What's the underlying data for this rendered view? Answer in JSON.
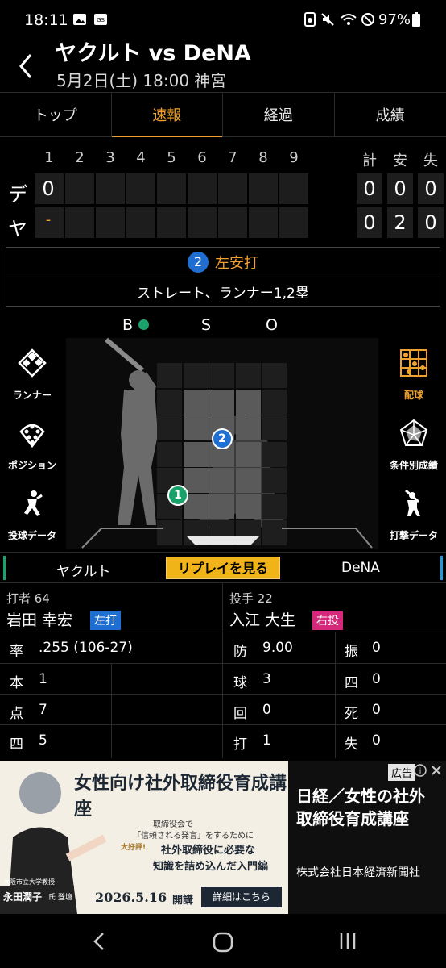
{
  "status": {
    "time": "18:11",
    "battery": "97%"
  },
  "header": {
    "title": "ヤクルト vs DeNA",
    "subtitle": "5月2日(土) 18:00 神宮"
  },
  "tabs": [
    {
      "label": "トップ"
    },
    {
      "label": "速報"
    },
    {
      "label": "経過"
    },
    {
      "label": "成績"
    }
  ],
  "scoreboard": {
    "innings": [
      "1",
      "2",
      "3",
      "4",
      "5",
      "6",
      "7",
      "8",
      "9"
    ],
    "totals_headers": [
      "計",
      "安",
      "失"
    ],
    "teams": [
      {
        "abbr": "デ",
        "inning_scores": [
          "0"
        ],
        "totals": [
          "0",
          "0",
          "0"
        ]
      },
      {
        "abbr": "ヤ",
        "inning_scores": [
          "-"
        ],
        "totals": [
          "0",
          "2",
          "0"
        ]
      }
    ]
  },
  "play": {
    "number": "2",
    "result": "左安打",
    "description": "ストレート、ランナー1,2塁"
  },
  "count": {
    "b": "B",
    "s": "S",
    "o": "O",
    "balls": 1,
    "strikes": 0,
    "outs": 0
  },
  "side_left": [
    {
      "label": "ランナー",
      "icon": "diamond-icon"
    },
    {
      "label": "ポジション",
      "icon": "position-icon"
    },
    {
      "label": "投球データ",
      "icon": "pitcher-icon"
    }
  ],
  "side_right": [
    {
      "label": "配球",
      "icon": "pitch-grid-icon"
    },
    {
      "label": "条件別成績",
      "icon": "radar-icon"
    },
    {
      "label": "打撃データ",
      "icon": "batter-icon"
    }
  ],
  "pitches": [
    {
      "number": "1",
      "color": "#19a36a"
    },
    {
      "number": "2",
      "color": "#1f6fd3"
    }
  ],
  "teambar": {
    "left": "ヤクルト",
    "replay": "リプレイを見る",
    "right": "DeNA"
  },
  "batter": {
    "role_label": "打者 64",
    "name": "岩田 幸宏",
    "hand": "左打",
    "hand_color": "#1f6fd3",
    "stats": [
      {
        "label": "率",
        "value": ".255 (106-27)"
      },
      {
        "label": "本",
        "value": "1"
      },
      {
        "label": "点",
        "value": "7"
      },
      {
        "label": "四",
        "value": "5"
      }
    ]
  },
  "pitcher": {
    "role_label": "投手 22",
    "name": "入江 大生",
    "hand": "右投",
    "hand_color": "#d6287a",
    "stats": [
      {
        "label": "防",
        "value": "9.00"
      },
      {
        "label": "球",
        "value": "3"
      },
      {
        "label": "回",
        "value": "0"
      },
      {
        "label": "打",
        "value": "1"
      }
    ],
    "stats2": [
      {
        "label": "振",
        "value": "0"
      },
      {
        "label": "四",
        "value": "0"
      },
      {
        "label": "死",
        "value": "0"
      },
      {
        "label": "失",
        "value": "0"
      }
    ]
  },
  "ad": {
    "label": "広告",
    "title": "日経／女性の社外取締役育成講座",
    "company": "株式会社日本経済新聞社",
    "banner_headline": "女性向け社外取締役育成講座",
    "banner_lines": [
      "取締役会で",
      "「信頼される発言」をするために",
      "社外取締役に必要な",
      "知識を詰め込んだ入門編"
    ],
    "banner_date": "2026.5.16",
    "banner_open": "開講",
    "banner_detail": "詳細はこちら",
    "banner_person_title": "大阪市立大学教授",
    "banner_person": "永田潤子",
    "banner_person_suffix": "氏 登壇",
    "banner_badge": "大好評!"
  }
}
